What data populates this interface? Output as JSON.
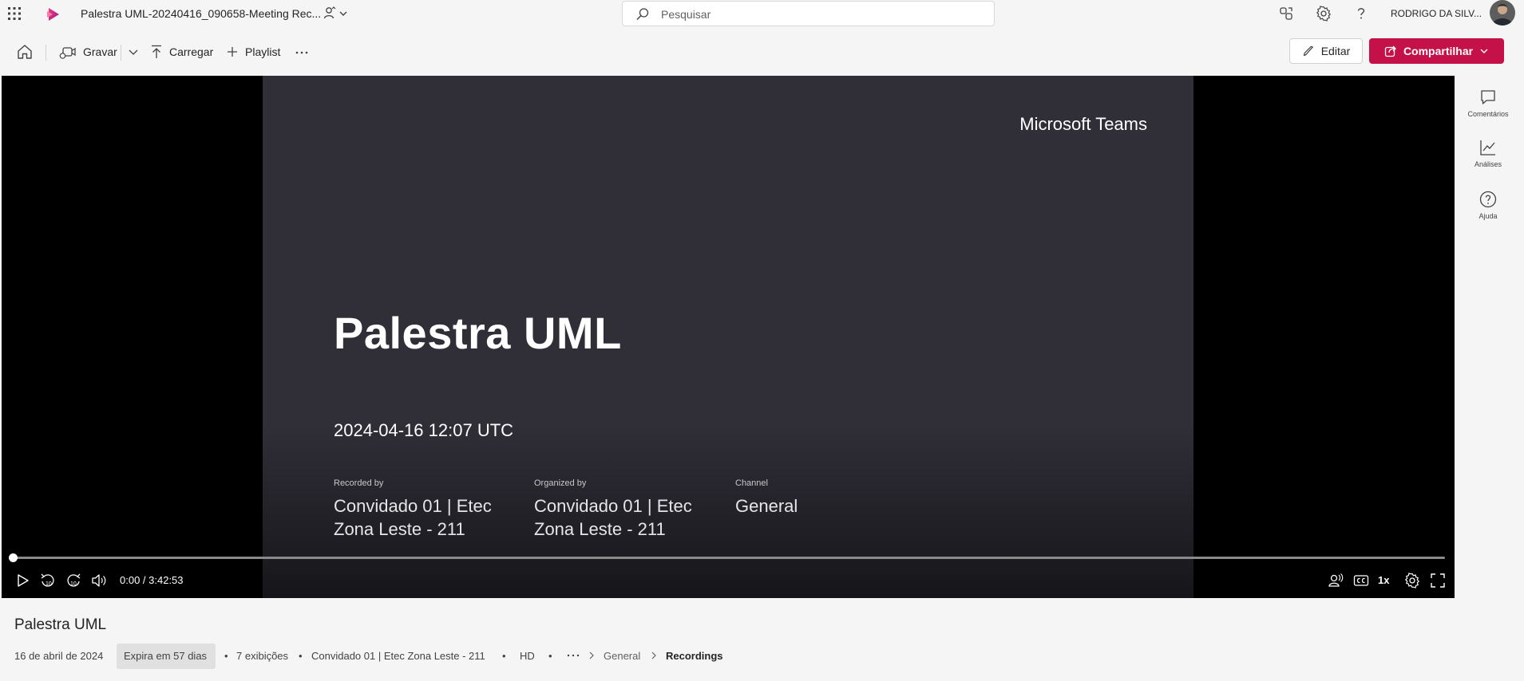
{
  "topbar": {
    "doc_title": "Palestra UML-20240416_090658-Meeting Rec...",
    "search_placeholder": "Pesquisar",
    "user_name": "RODRIGO DA SILV..."
  },
  "commandbar": {
    "record_label": "Gravar",
    "upload_label": "Carregar",
    "playlist_label": "Playlist",
    "edit_label": "Editar",
    "share_label": "Compartilhar"
  },
  "slide": {
    "brand": "Microsoft Teams",
    "title": "Palestra UML",
    "datetime": "2024-04-16 12:07 UTC",
    "recorded_by_label": "Recorded by",
    "recorded_by_line1": "Convidado 01 | Etec",
    "recorded_by_line2": "Zona Leste - 211",
    "organized_by_label": "Organized by",
    "organized_by_line1": "Convidado 01 | Etec",
    "organized_by_line2": "Zona Leste - 211",
    "channel_label": "Channel",
    "channel_value": "General"
  },
  "player": {
    "time": "0:00 / 3:42:53",
    "progress_fraction": 0,
    "speed": "1x",
    "skip_back": "10",
    "skip_forward": "10"
  },
  "rail": {
    "comments": "Comentários",
    "analytics": "Análises",
    "help": "Ajuda"
  },
  "info": {
    "title": "Palestra UML",
    "date": "16 de abril de 2024",
    "expires": "Expira em 57 dias",
    "views": "7 exibições",
    "owner": "Convidado 01 | Etec Zona Leste - 211",
    "quality": "HD",
    "breadcrumb_channel": "General",
    "breadcrumb_folder": "Recordings"
  },
  "colors": {
    "accent": "#c4114a",
    "slide_bg": "#302f38"
  }
}
